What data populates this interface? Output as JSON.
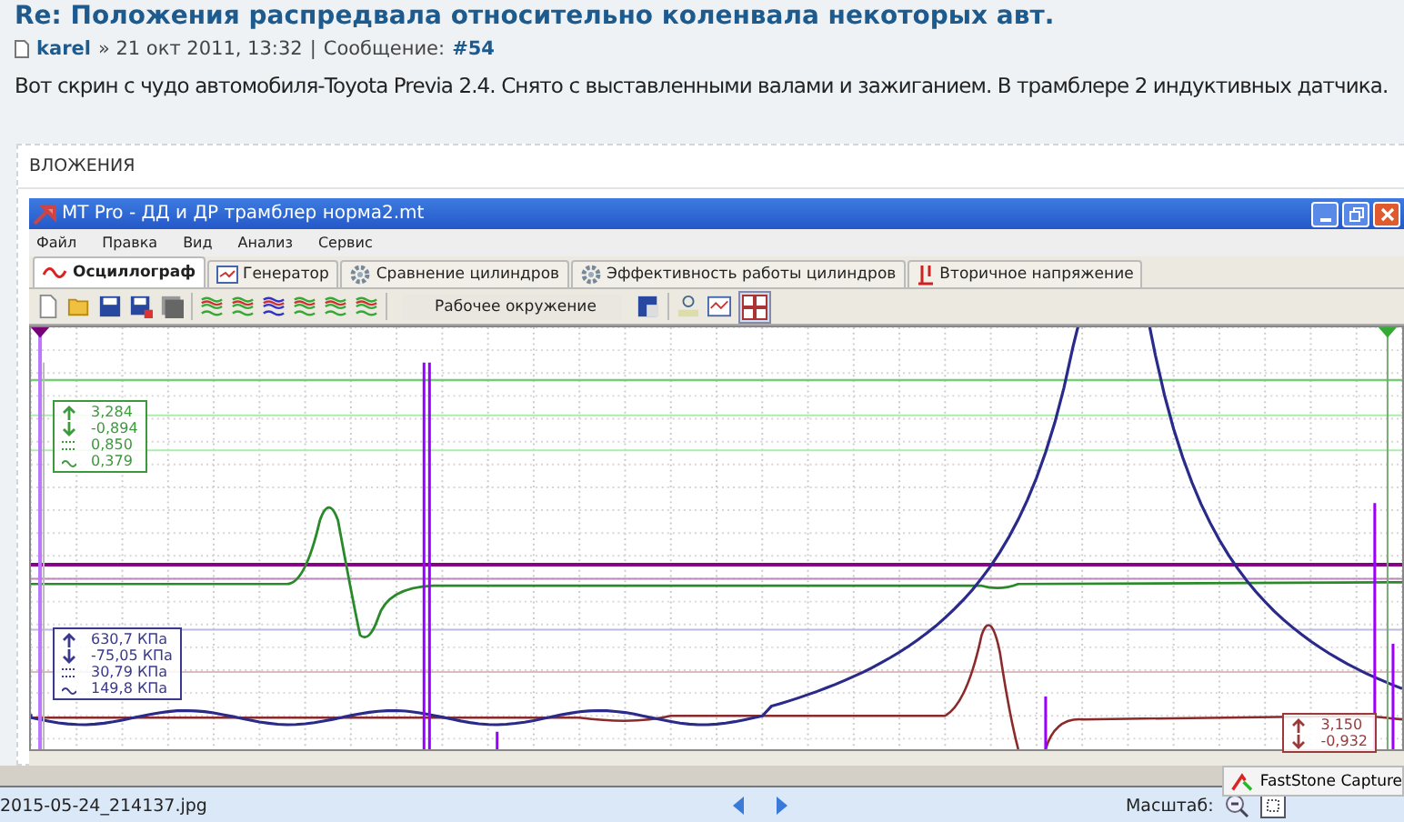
{
  "post": {
    "title": "Re: Положения распредвала относительно коленвала некоторых авт.",
    "author": "karel",
    "date": "» 21 окт 2011, 13:32",
    "separator": "|",
    "message_label": "Сообщение:",
    "message_number": "#54",
    "body": "Вот скрин с чудо автомобиля-Toyota Previa 2.4. Снято с выставленными валами и зажиганием. В трамблере 2 индуктивных датчика."
  },
  "attachments_label": "ВЛОЖЕНИЯ",
  "app": {
    "title": "MT Pro - ДД и ДР трамблер норма2.mt",
    "menu": [
      "Файл",
      "Правка",
      "Вид",
      "Анализ",
      "Сервис"
    ],
    "tabs": [
      {
        "label": "Осциллограф",
        "selected": true,
        "kind": "wave"
      },
      {
        "label": "Генератор",
        "selected": false,
        "kind": "generator"
      },
      {
        "label": "Сравнение цилиндров",
        "selected": false,
        "kind": "gear"
      },
      {
        "label": "Эффективность работы цилиндров",
        "selected": false,
        "kind": "gear"
      },
      {
        "label": "Вторичное напряжение",
        "selected": false,
        "kind": "spark"
      }
    ],
    "workspace": "Рабочее окружение",
    "readouts": [
      {
        "color": "#3c9a3c",
        "values": [
          "3,284",
          "-0,894",
          "0,850",
          "0,379"
        ]
      },
      {
        "color": "#3a3a8c",
        "values": [
          "630,7 КПа",
          "-75,05 КПа",
          "30,79 КПа",
          "149,8 КПа"
        ]
      },
      {
        "color": "#9a3a3a",
        "values": [
          "3,150",
          "-0,932"
        ]
      }
    ]
  },
  "viewer": {
    "filename": "2015-05-24_214137.jpg",
    "popup": "FastStone Capture",
    "zoom_label": "Масштаб:"
  }
}
